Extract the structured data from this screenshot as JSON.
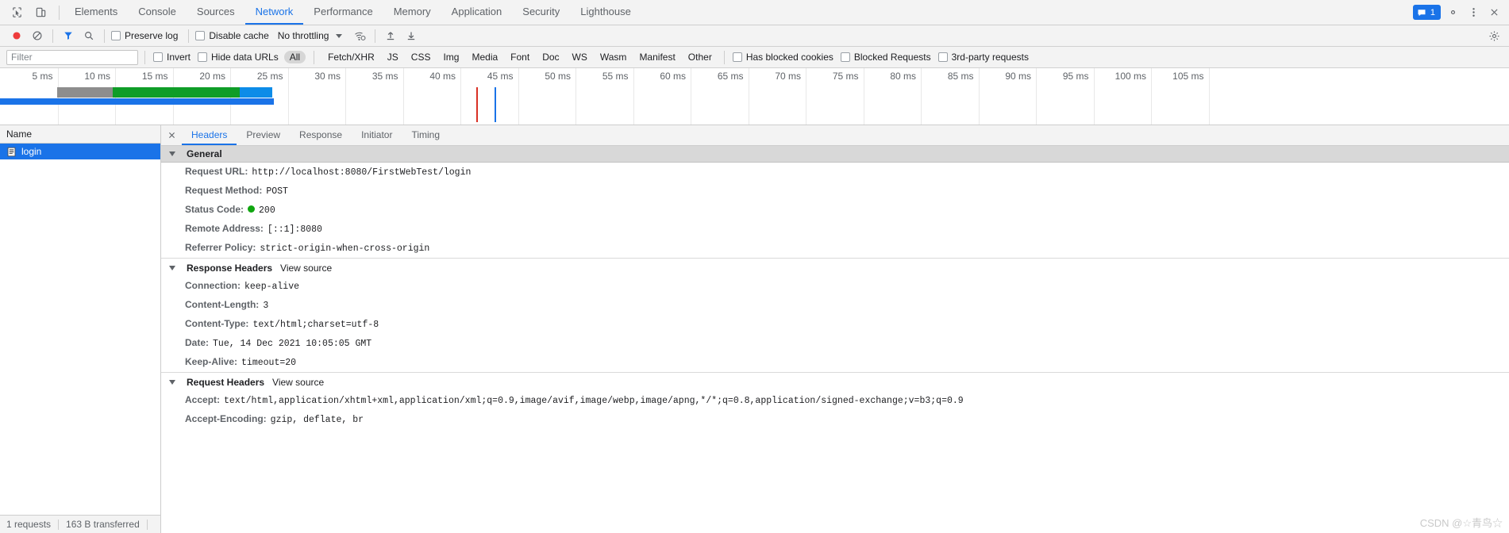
{
  "devtools": {
    "inspect_icon": "cursor-inspect-icon",
    "device_icon": "device-toolbar-icon",
    "tabs": [
      {
        "label": "Elements",
        "active": false
      },
      {
        "label": "Console",
        "active": false
      },
      {
        "label": "Sources",
        "active": false
      },
      {
        "label": "Network",
        "active": true
      },
      {
        "label": "Performance",
        "active": false
      },
      {
        "label": "Memory",
        "active": false
      },
      {
        "label": "Application",
        "active": false
      },
      {
        "label": "Security",
        "active": false
      },
      {
        "label": "Lighthouse",
        "active": false
      }
    ],
    "issues_count": "1",
    "settings_icon": "gear-icon",
    "more_icon": "kebab-menu-icon",
    "close_icon": "close-icon"
  },
  "toolbar": {
    "record_icon": "record-button",
    "clear_icon": "clear-icon",
    "filter_icon": "funnel-icon",
    "search_icon": "search-icon",
    "preserve_log": "Preserve log",
    "disable_cache": "Disable cache",
    "throttling": "No throttling",
    "wifi_icon": "network-conditions-icon",
    "import_icon": "import-har-icon",
    "export_icon": "export-har-icon",
    "settings_icon": "settings-gear-icon"
  },
  "filters": {
    "placeholder": "Filter",
    "value": "",
    "invert": "Invert",
    "hide_data_urls": "Hide data URLs",
    "types": [
      {
        "label": "All",
        "selected": true
      },
      {
        "label": "Fetch/XHR",
        "selected": false
      },
      {
        "label": "JS",
        "selected": false
      },
      {
        "label": "CSS",
        "selected": false
      },
      {
        "label": "Img",
        "selected": false
      },
      {
        "label": "Media",
        "selected": false
      },
      {
        "label": "Font",
        "selected": false
      },
      {
        "label": "Doc",
        "selected": false
      },
      {
        "label": "WS",
        "selected": false
      },
      {
        "label": "Wasm",
        "selected": false
      },
      {
        "label": "Manifest",
        "selected": false
      },
      {
        "label": "Other",
        "selected": false
      }
    ],
    "has_blocked_cookies": "Has blocked cookies",
    "blocked_requests": "Blocked Requests",
    "third_party": "3rd-party requests"
  },
  "overview": {
    "ticks": [
      "5 ms",
      "10 ms",
      "15 ms",
      "20 ms",
      "25 ms",
      "30 ms",
      "35 ms",
      "40 ms",
      "45 ms",
      "50 ms",
      "55 ms",
      "60 ms",
      "65 ms",
      "70 ms",
      "75 ms",
      "80 ms",
      "85 ms",
      "90 ms",
      "95 ms",
      "100 ms",
      "105 ms"
    ],
    "dom_content_loaded_color": "#d93025",
    "load_event_color": "#1a73e8",
    "bar_colors": {
      "queueing": "#ffffff",
      "stalled": "#8d8d8d",
      "waiting": "#0f9d28",
      "download": "#0d8ce8",
      "total": "#1a73e8"
    }
  },
  "requests": {
    "column_name": "Name",
    "rows": [
      {
        "name": "login",
        "icon": "document-icon",
        "selected": true
      }
    ]
  },
  "detail": {
    "tabs": [
      {
        "label": "Headers",
        "active": true
      },
      {
        "label": "Preview",
        "active": false
      },
      {
        "label": "Response",
        "active": false
      },
      {
        "label": "Initiator",
        "active": false
      },
      {
        "label": "Timing",
        "active": false
      }
    ],
    "sections": [
      {
        "title": "General",
        "view_source": "",
        "items": [
          {
            "key": "Request URL:",
            "value": "http://localhost:8080/FirstWebTest/login"
          },
          {
            "key": "Request Method:",
            "value": "POST"
          },
          {
            "key": "Status Code:",
            "value": "200",
            "status_dot": true
          },
          {
            "key": "Remote Address:",
            "value": "[::1]:8080"
          },
          {
            "key": "Referrer Policy:",
            "value": "strict-origin-when-cross-origin"
          }
        ]
      },
      {
        "title": "Response Headers",
        "view_source": "View source",
        "items": [
          {
            "key": "Connection:",
            "value": "keep-alive"
          },
          {
            "key": "Content-Length:",
            "value": "3"
          },
          {
            "key": "Content-Type:",
            "value": "text/html;charset=utf-8"
          },
          {
            "key": "Date:",
            "value": "Tue, 14 Dec 2021 10:05:05 GMT"
          },
          {
            "key": "Keep-Alive:",
            "value": "timeout=20"
          }
        ]
      },
      {
        "title": "Request Headers",
        "view_source": "View source",
        "items": [
          {
            "key": "Accept:",
            "value": "text/html,application/xhtml+xml,application/xml;q=0.9,image/avif,image/webp,image/apng,*/*;q=0.8,application/signed-exchange;v=b3;q=0.9"
          },
          {
            "key": "Accept-Encoding:",
            "value": "gzip, deflate, br"
          }
        ]
      }
    ]
  },
  "statusbar": {
    "requests": "1 requests",
    "transferred": "163 B transferred"
  },
  "watermark": "CSDN @☆青鸟☆"
}
